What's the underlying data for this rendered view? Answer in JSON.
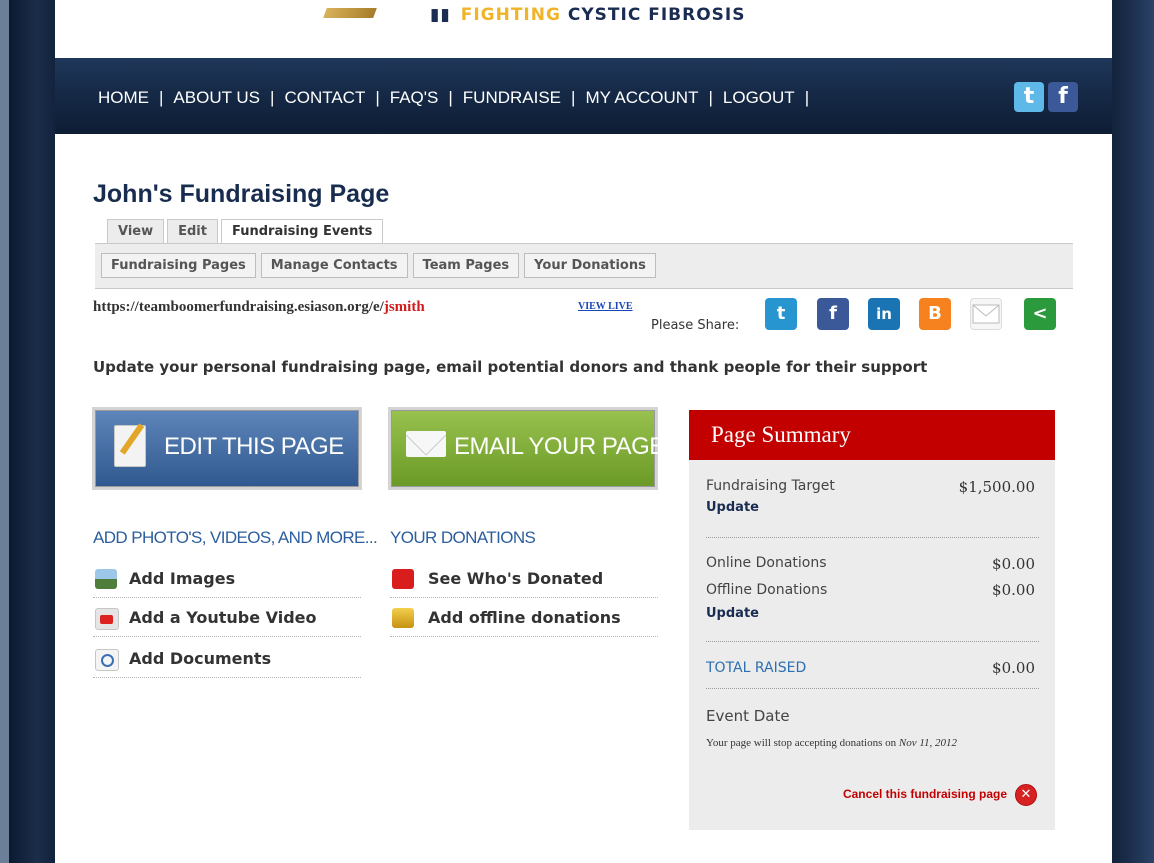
{
  "logo": {
    "text_a": "FIGHTING",
    "text_b": "CYSTIC FIBROSIS"
  },
  "nav": {
    "items": [
      "HOME",
      "ABOUT US",
      "CONTACT",
      "FAQ'S",
      "FUNDRAISE",
      "MY ACCOUNT",
      "LOGOUT"
    ],
    "separator": "|",
    "social": {
      "twitter": "t",
      "facebook": "f"
    }
  },
  "page_title": "John's Fundraising Page",
  "tabs": [
    "View",
    "Edit",
    "Fundraising Events"
  ],
  "subtabs": [
    "Fundraising Pages",
    "Manage Contacts",
    "Team Pages",
    "Your Donations"
  ],
  "url": {
    "base": "https://teamboomerfundraising.esiason.org/e/",
    "user": "jsmith",
    "view_live": "VIEW LIVE"
  },
  "share": {
    "label": "Please Share:",
    "icons": [
      "twitter-icon",
      "facebook-icon",
      "linkedin-icon",
      "blogger-icon",
      "email-icon",
      "share-icon"
    ],
    "glyphs": {
      "twitter": "t",
      "facebook": "f",
      "linkedin": "in",
      "blogger": "B",
      "share": "<"
    }
  },
  "intro": "Update your personal fundraising page, email potential donors and thank people for their support",
  "buttons": {
    "edit": "EDIT THIS PAGE",
    "email": "EMAIL YOUR PAGE"
  },
  "add_section": {
    "heading": "ADD PHOTO'S, VIDEOS, AND MORE...",
    "items": [
      "Add Images",
      "Add a Youtube Video",
      "Add Documents"
    ]
  },
  "donations_section": {
    "heading": "YOUR DONATIONS",
    "items": [
      "See Who's Donated",
      "Add offline donations"
    ]
  },
  "summary": {
    "title": "Page Summary",
    "target_label": "Fundraising Target",
    "target_value": "$1,500.00",
    "update": "Update",
    "online_label": "Online Donations",
    "online_value": "$0.00",
    "offline_label": "Offline Donations",
    "offline_value": "$0.00",
    "total_label": "TOTAL RAISED",
    "total_value": "$0.00",
    "event_label": "Event Date",
    "event_note": "Your page will stop accepting donations on",
    "event_date": "Nov 11, 2012",
    "cancel": "Cancel this fundraising page",
    "cancel_glyph": "✕"
  },
  "colors": {
    "nav_bg": "#142743",
    "title": "#172c4e",
    "summary_header": "#c30000",
    "link_blue": "#2c5e9e"
  }
}
